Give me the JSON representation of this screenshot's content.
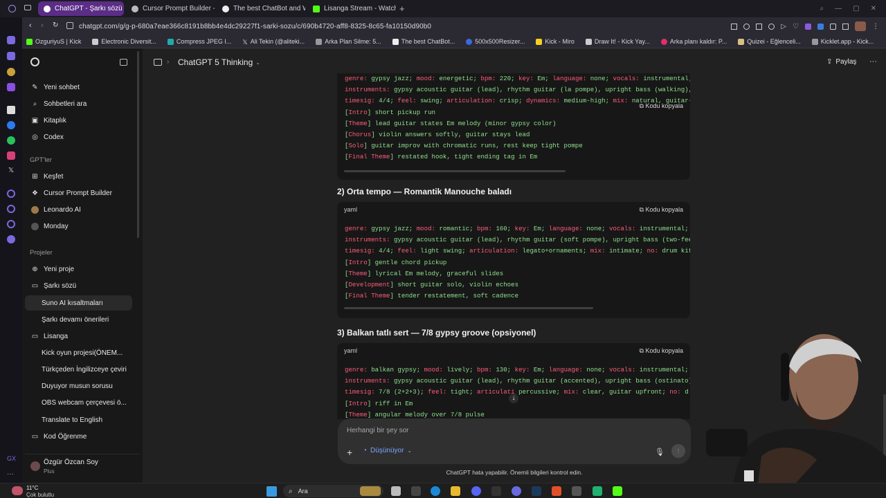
{
  "browser": {
    "tabs": [
      {
        "label": "ChatGPT - Şarkı sözü",
        "active": true,
        "color": "#5b2d86"
      },
      {
        "label": "Cursor Prompt Builder - C",
        "active": false
      },
      {
        "label": "The best ChatBot and Wr",
        "active": false
      },
      {
        "label": "Lisanga Stream - Watch L",
        "active": false
      }
    ],
    "url": "chatgpt.com/g/g-p-680a7eae366c8191b8bb4e4dc29227f1-sarki-sozu/c/690b4720-aff8-8325-8c65-fa10150d90b0",
    "bookmarks": [
      "OzguriyuS | Kick",
      "Electronic Diversit...",
      "Compress JPEG I...",
      "Ali Tekin (@aliteki...",
      "Arka Plan Silme: 5...",
      "The best ChatBot...",
      "500x500Resizer...",
      "Kick - Miro",
      "Draw It! - Kick Yay...",
      "Arka planı kaldır: P...",
      "Quizei - Eğlenceli...",
      "Kicklet.app - Kick..."
    ]
  },
  "sidebar": {
    "top": [
      {
        "label": "Yeni sohbet",
        "icon": "edit-icon"
      },
      {
        "label": "Sohbetleri ara",
        "icon": "search-icon"
      },
      {
        "label": "Kitaplık",
        "icon": "library-icon"
      },
      {
        "label": "Codex",
        "icon": "codex-icon"
      }
    ],
    "gpts_label": "GPT'ler",
    "gpts": [
      {
        "label": "Keşfet",
        "icon": "grid-icon"
      },
      {
        "label": "Cursor Prompt Builder",
        "icon": "cursor-icon"
      },
      {
        "label": "Leonardo AI",
        "icon": "leonardo-icon"
      },
      {
        "label": "Monday",
        "icon": "monday-icon"
      }
    ],
    "projects_label": "Projeler",
    "projects": [
      {
        "label": "Yeni proje",
        "type": "item"
      },
      {
        "label": "Şarkı sözü",
        "type": "folder"
      },
      {
        "label": "Suno AI kısaltmaları",
        "type": "sub",
        "selected": true
      },
      {
        "label": "Şarkı devamı önerileri",
        "type": "sub"
      },
      {
        "label": "Lisanga",
        "type": "folder"
      },
      {
        "label": "Kick oyun projesi(ÖNEM...",
        "type": "sub"
      },
      {
        "label": "Türkçeden İngilizceye çeviri",
        "type": "sub"
      },
      {
        "label": "Duyuyor musun sorusu",
        "type": "sub"
      },
      {
        "label": "OBS webcam çerçevesi ö...",
        "type": "sub"
      },
      {
        "label": "Translate to English",
        "type": "sub"
      },
      {
        "label": "Kod Öğrenme",
        "type": "folder"
      }
    ],
    "user": {
      "name": "Özgür Özcan Soy",
      "plan": "Plus"
    }
  },
  "header": {
    "model": "ChatGPT 5 Thinking",
    "share": "Paylaş"
  },
  "code_blocks": [
    {
      "lang": "yaml",
      "copy_label": "Kodu kopyala",
      "lines": [
        [
          [
            "k",
            "genre: "
          ],
          [
            "v",
            "gypsy jazz; "
          ],
          [
            "k",
            "mood: "
          ],
          [
            "v",
            "energetic; "
          ],
          [
            "k",
            "bpm: "
          ],
          [
            "v",
            "220; "
          ],
          [
            "k",
            "key: "
          ],
          [
            "v",
            "Em; "
          ],
          [
            "k",
            "language: "
          ],
          [
            "v",
            "none; "
          ],
          [
            "k",
            "vocals: "
          ],
          [
            "v",
            "instrumental;"
          ]
        ],
        [
          [
            "k",
            "instruments: "
          ],
          [
            "v",
            "gypsy acoustic guitar (lead), rhythm guitar (la pompe), upright bass (walking), v"
          ]
        ],
        [
          [
            "k",
            "timesig: "
          ],
          [
            "v",
            "4/4; "
          ],
          [
            "k",
            "feel: "
          ],
          [
            "v",
            "swing; "
          ],
          [
            "k",
            "articulation: "
          ],
          [
            "v",
            "crisp; "
          ],
          [
            "k",
            "dynamics: "
          ],
          [
            "v",
            "medium-high; "
          ],
          [
            "k",
            "mix: "
          ],
          [
            "v",
            "natural, guitar-fo"
          ]
        ],
        [
          [
            "v",
            "["
          ],
          [
            "k",
            "Intro"
          ],
          [
            "v",
            "] short pickup run"
          ]
        ],
        [
          [
            "v",
            "["
          ],
          [
            "k",
            "Theme"
          ],
          [
            "v",
            "] lead guitar states Em melody (minor gypsy color)"
          ]
        ],
        [
          [
            "v",
            "["
          ],
          [
            "k",
            "Chorus"
          ],
          [
            "v",
            "] violin answers softly, guitar stays lead"
          ]
        ],
        [
          [
            "v",
            "["
          ],
          [
            "k",
            "Solo"
          ],
          [
            "v",
            "] guitar improv with chromatic runs, rest keep tight pompe"
          ]
        ],
        [
          [
            "v",
            "["
          ],
          [
            "k",
            "Final Theme"
          ],
          [
            "v",
            "] restated hook, tight ending tag in Em"
          ]
        ]
      ]
    },
    {
      "heading": "2) Orta tempo — Romantik Manouche baladı",
      "lang": "yaml",
      "copy_label": "Kodu kopyala",
      "lines": [
        [
          [
            "k",
            "genre: "
          ],
          [
            "v",
            "gypsy jazz; "
          ],
          [
            "k",
            "mood: "
          ],
          [
            "v",
            "romantic; "
          ],
          [
            "k",
            "bpm: "
          ],
          [
            "v",
            "160; "
          ],
          [
            "k",
            "key: "
          ],
          [
            "v",
            "Em; "
          ],
          [
            "k",
            "language: "
          ],
          [
            "v",
            "none; "
          ],
          [
            "k",
            "vocals: "
          ],
          [
            "v",
            "instrumental;"
          ]
        ],
        [
          [
            "k",
            "instruments: "
          ],
          [
            "v",
            "gypsy acoustic guitar (lead), rhythm guitar (soft pompe), upright bass (two-feel)"
          ]
        ],
        [
          [
            "k",
            "timesig: "
          ],
          [
            "v",
            "4/4; "
          ],
          [
            "k",
            "feel: "
          ],
          [
            "v",
            "light swing; "
          ],
          [
            "k",
            "articulation: "
          ],
          [
            "v",
            "legato+ornaments; "
          ],
          [
            "k",
            "mix: "
          ],
          [
            "v",
            "intimate; "
          ],
          [
            "k",
            "no: "
          ],
          [
            "v",
            "drum kit,"
          ]
        ],
        [
          [
            "v",
            "["
          ],
          [
            "k",
            "Intro"
          ],
          [
            "v",
            "] gentle chord pickup"
          ]
        ],
        [
          [
            "v",
            "["
          ],
          [
            "k",
            "Theme"
          ],
          [
            "v",
            "] lyrical Em melody, graceful slides"
          ]
        ],
        [
          [
            "v",
            "["
          ],
          [
            "k",
            "Development"
          ],
          [
            "v",
            "] short guitar solo, violin echoes"
          ]
        ],
        [
          [
            "v",
            "["
          ],
          [
            "k",
            "Final Theme"
          ],
          [
            "v",
            "] tender restatement, soft cadence"
          ]
        ]
      ]
    },
    {
      "heading": "3) Balkan tatlı sert — 7/8 gypsy groove (opsiyonel)",
      "lang": "yaml",
      "copy_label": "Kodu kopyala",
      "lines": [
        [
          [
            "k",
            "genre: "
          ],
          [
            "v",
            "balkan gypsy; "
          ],
          [
            "k",
            "mood: "
          ],
          [
            "v",
            "lively; "
          ],
          [
            "k",
            "bpm: "
          ],
          [
            "v",
            "130; "
          ],
          [
            "k",
            "key: "
          ],
          [
            "v",
            "Em; "
          ],
          [
            "k",
            "language: "
          ],
          [
            "v",
            "none; "
          ],
          [
            "k",
            "vocals: "
          ],
          [
            "v",
            "instrumental;"
          ]
        ],
        [
          [
            "k",
            "instruments: "
          ],
          [
            "v",
            "gypsy acoustic guitar (lead), rhythm guitar (accented), upright bass (ostinato),"
          ]
        ],
        [
          [
            "k",
            "timesig: "
          ],
          [
            "v",
            "7/8 (2+2+3); "
          ],
          [
            "k",
            "feel: "
          ],
          [
            "v",
            "tight; "
          ],
          [
            "k",
            "articulati"
          ],
          [
            "v",
            "    percussive; "
          ],
          [
            "k",
            "mix: "
          ],
          [
            "v",
            "clear, guitar upfront; "
          ],
          [
            "k",
            "no: "
          ],
          [
            "v",
            "d"
          ]
        ],
        [
          [
            "v",
            "["
          ],
          [
            "k",
            "Intro"
          ],
          [
            "v",
            "] riff in Em"
          ]
        ],
        [
          [
            "v",
            "["
          ],
          [
            "k",
            "Theme"
          ],
          [
            "v",
            "] angular melody over 7/8 pulse"
          ]
        ]
      ]
    }
  ],
  "composer": {
    "placeholder": "Herhangi bir şey sor",
    "mode": "Düşünüyor",
    "disclaimer": "ChatGPT hata yapabilir. Önemli bilgileri kontrol edin."
  },
  "taskbar": {
    "weather_temp": "11°C",
    "weather_desc": "Çok bulutlu",
    "search": "Ara"
  },
  "colors": {
    "accent": "#5b2d86",
    "code_key": "#ff5c7a",
    "code_value": "#8fe08f"
  }
}
